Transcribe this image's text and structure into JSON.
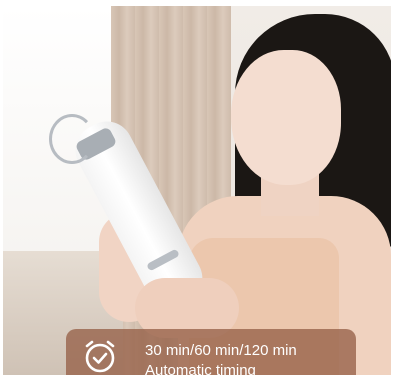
{
  "caption": {
    "line1": "30 min/60 min/120 min",
    "line2": "Automatic timing",
    "icon": "alarm-clock-check-icon"
  }
}
